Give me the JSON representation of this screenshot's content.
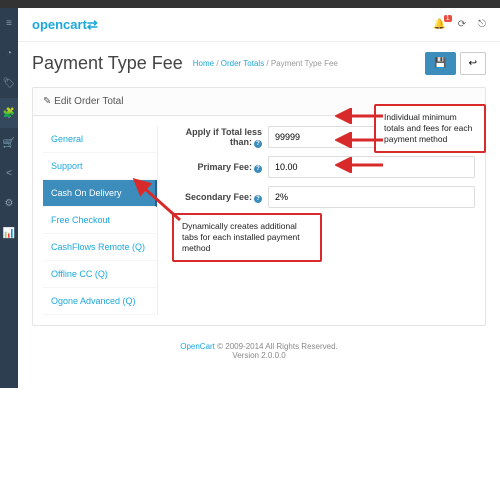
{
  "header": {
    "logo_text": "opencart",
    "notification_count": "1"
  },
  "page": {
    "title": "Payment Type Fee",
    "breadcrumb": {
      "home": "Home",
      "parent": "Order Totals",
      "current": "Payment Type Fee"
    }
  },
  "panel": {
    "title": "Edit Order Total"
  },
  "tabs": [
    {
      "label": "General"
    },
    {
      "label": "Support"
    },
    {
      "label": "Cash On Delivery"
    },
    {
      "label": "Free Checkout"
    },
    {
      "label": "CashFlows Remote (Q)"
    },
    {
      "label": "Offline CC (Q)"
    },
    {
      "label": "Ogone Advanced (Q)"
    }
  ],
  "form": {
    "apply_label": "Apply if Total less than:",
    "apply_value": "99999",
    "primary_label": "Primary Fee:",
    "primary_value": "10.00",
    "secondary_label": "Secondary Fee:",
    "secondary_value": "2%"
  },
  "callouts": {
    "right": "Individual minimum totals and fees for each payment method",
    "bottom": "Dynamically creates additional tabs for each installed payment method"
  },
  "footer": {
    "link": "OpenCart",
    "copy": " © 2009-2014 All Rights Reserved.",
    "version": "Version 2.0.0.0"
  }
}
